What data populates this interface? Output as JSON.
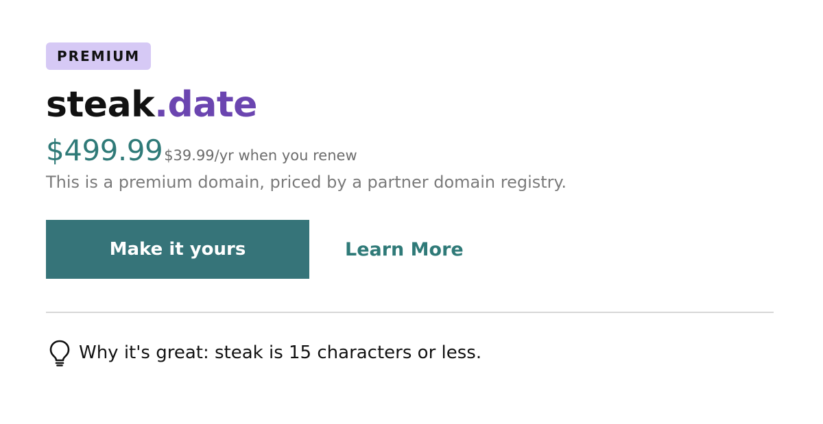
{
  "badge": "PREMIUM",
  "domain": {
    "sld": "steak",
    "tld": ".date"
  },
  "pricing": {
    "price": "$499.99",
    "renewal": "$39.99/yr when you renew",
    "description": "This is a premium domain, priced by a partner domain registry."
  },
  "actions": {
    "primary_label": "Make it yours",
    "secondary_label": "Learn More"
  },
  "why": {
    "icon": "lightbulb-icon",
    "text": "Why it's great: steak is 15 characters or less."
  },
  "colors": {
    "badge_bg": "#d6c9f5",
    "tld": "#6b45b0",
    "price": "#2f7a78",
    "button_bg": "#367479",
    "link": "#2f7a78"
  }
}
